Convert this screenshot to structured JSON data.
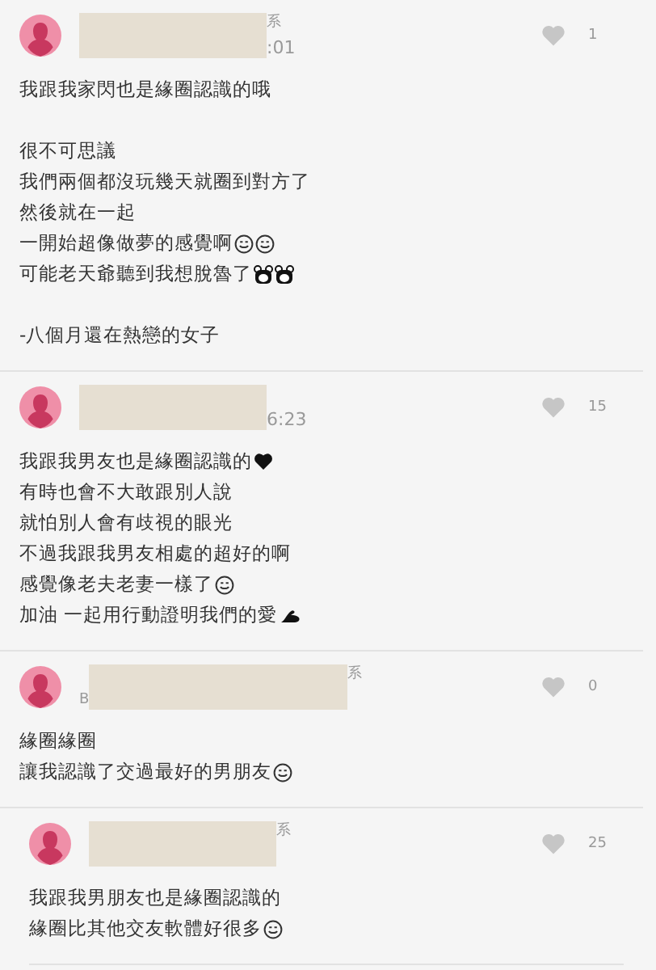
{
  "comments": [
    {
      "reply": false,
      "name_tail": "系",
      "time_tail": ":01",
      "liked": false,
      "likes": "1",
      "paragraphs": [
        [
          {
            "text": "我跟我家閃也是緣圈認識的哦"
          }
        ],
        [
          {
            "text": "很不可思議"
          },
          {
            "text": "我們兩個都沒玩幾天就圈到對方了"
          },
          {
            "text": "然後就在一起"
          },
          {
            "text": "一開始超像做夢的感覺啊",
            "emoji": [
              {
                "kind": "smile"
              },
              {
                "kind": "smile"
              }
            ]
          },
          {
            "text": "可能老天爺聽到我想脫魯了",
            "emoji": [
              {
                "kind": "bear"
              },
              {
                "kind": "bear"
              }
            ]
          }
        ],
        [
          {
            "text": "-八個月還在熱戀的女子"
          }
        ]
      ]
    },
    {
      "reply": false,
      "time_tail": "6:23",
      "liked": false,
      "likes": "15",
      "paragraphs": [
        [
          {
            "text": "我跟我男友也是緣圈認識的",
            "emoji": [
              {
                "kind": "heart"
              }
            ]
          },
          {
            "text": "有時也會不大敢跟別人說"
          },
          {
            "text": "就怕別人會有歧視的眼光"
          },
          {
            "text": "不過我跟我男友相處的超好的啊"
          },
          {
            "text": "感覺像老夫老妻一樣了",
            "emoji": [
              {
                "kind": "smile"
              }
            ]
          },
          {
            "text": "加油 一起用行動證明我們的愛",
            "emoji": [
              {
                "kind": "muscle"
              }
            ]
          }
        ]
      ]
    },
    {
      "reply": false,
      "name_tail": "系",
      "time_head": "B",
      "liked": false,
      "likes": "0",
      "paragraphs": [
        [
          {
            "text": "緣圈緣圈"
          },
          {
            "text": "讓我認識了交過最好的男朋友",
            "emoji": [
              {
                "kind": "smile"
              }
            ]
          }
        ]
      ]
    },
    {
      "reply": true,
      "name_tail": "系",
      "liked": false,
      "likes": "25",
      "paragraphs": [
        [
          {
            "text": "我跟我男朋友也是緣圈認識的"
          },
          {
            "text": "緣圈比其他交友軟體好很多",
            "emoji": [
              {
                "kind": "smile"
              }
            ]
          }
        ]
      ]
    }
  ]
}
